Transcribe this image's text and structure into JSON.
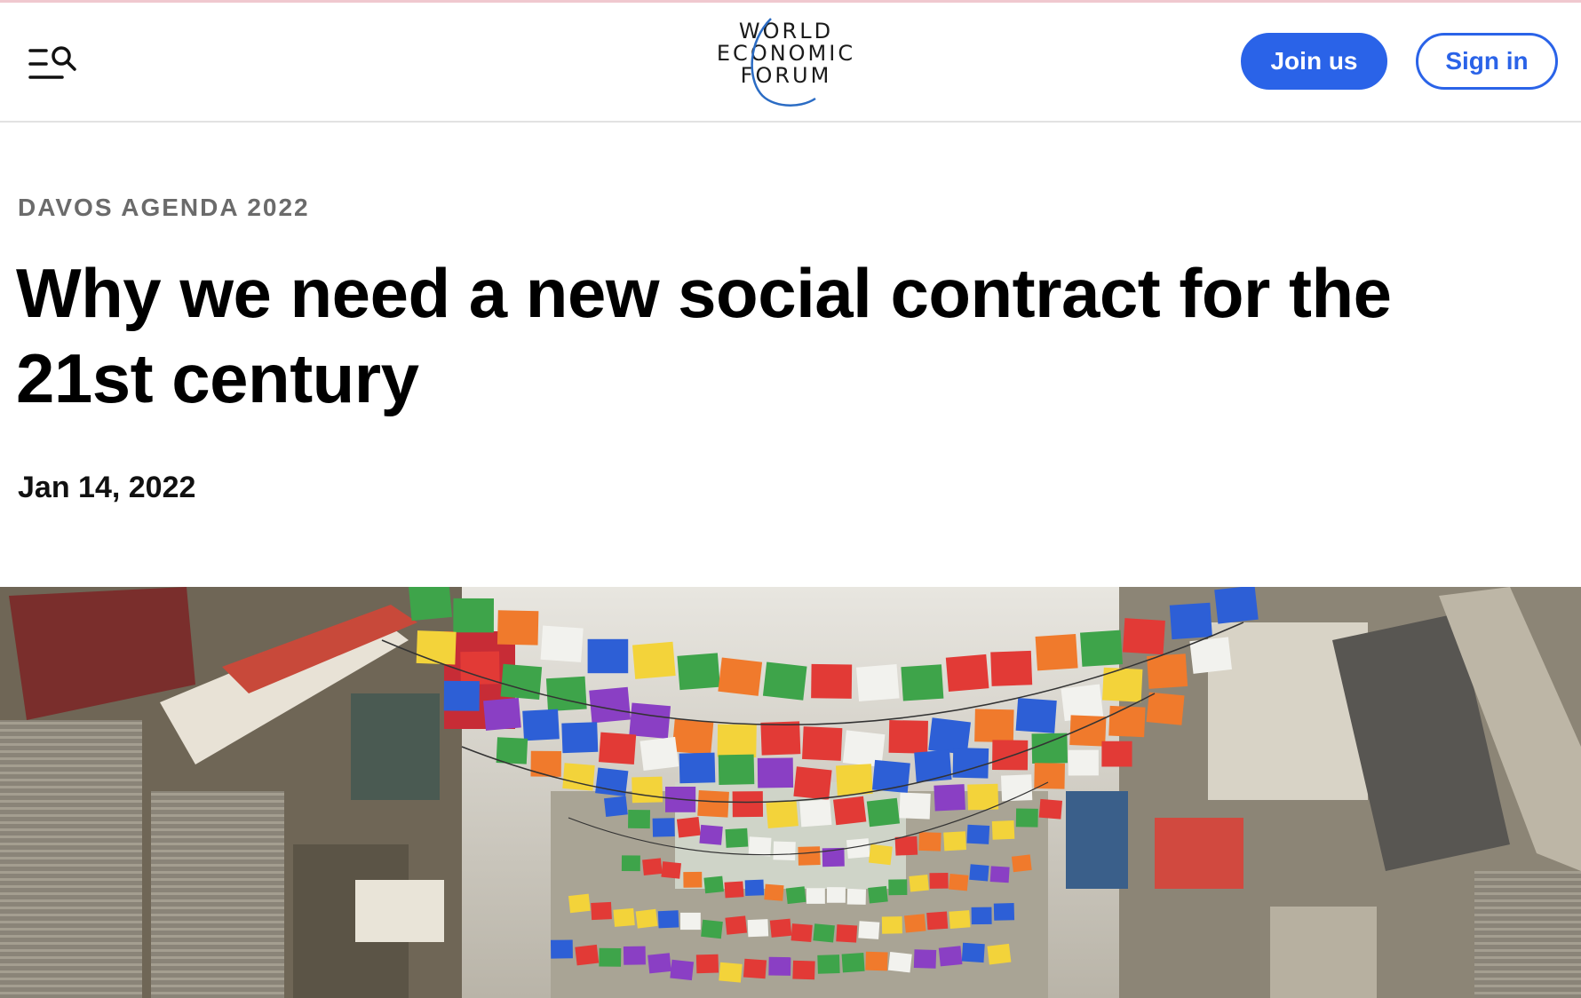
{
  "header": {
    "logo_lines": [
      "WORLD",
      "ECONOMIC",
      "FORUM"
    ],
    "join_label": "Join us",
    "signin_label": "Sign in",
    "menu_icon": "menu-search-icon",
    "accent_color": "#2a63e8"
  },
  "article": {
    "eyebrow": "DAVOS AGENDA 2022",
    "title": "Why we need a new social contract for the 21st century",
    "date": "Jan 14, 2022"
  }
}
